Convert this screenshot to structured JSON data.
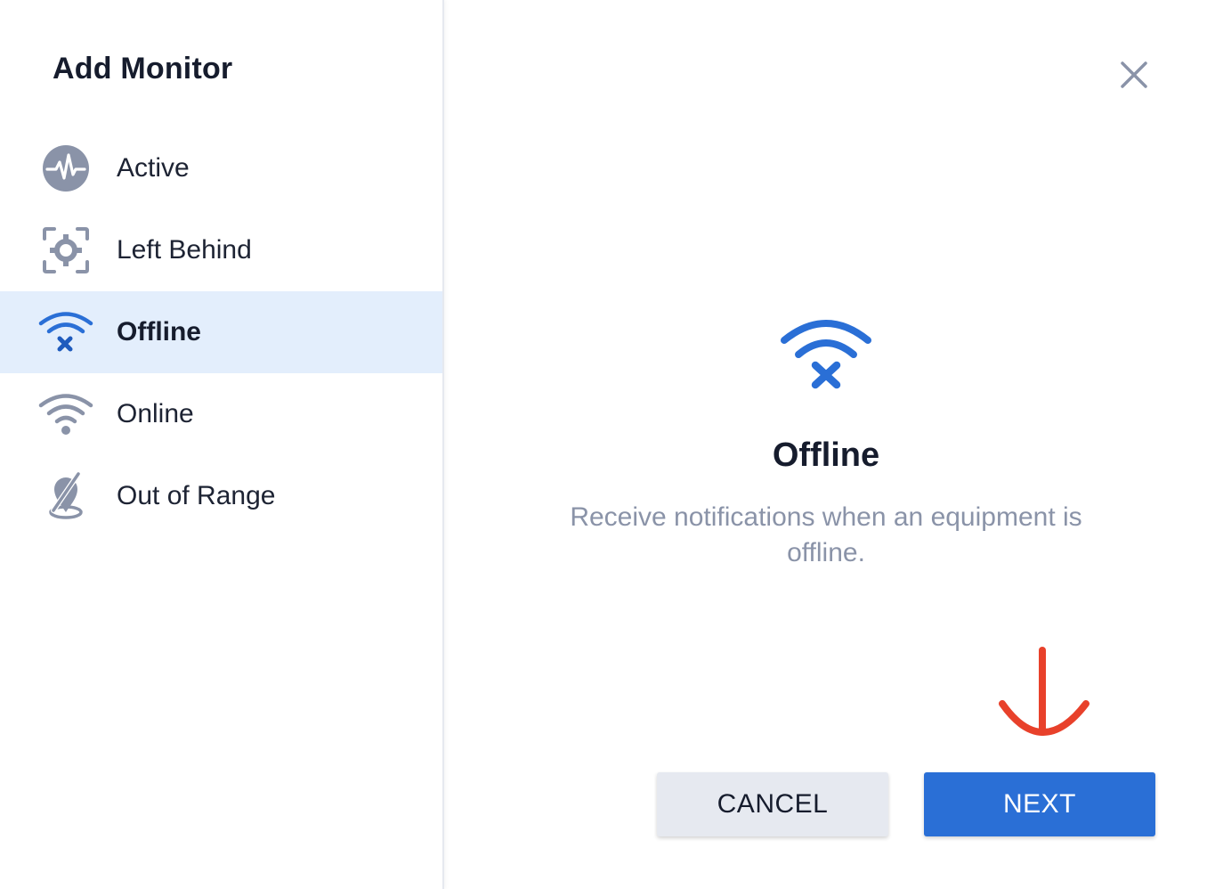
{
  "dialog": {
    "title": "Add Monitor",
    "close_icon": "close-icon"
  },
  "sidebar": {
    "items": [
      {
        "label": "Active",
        "icon": "pulse-icon",
        "selected": false
      },
      {
        "label": "Left Behind",
        "icon": "focus-target-icon",
        "selected": false
      },
      {
        "label": "Offline",
        "icon": "wifi-off-icon",
        "selected": true
      },
      {
        "label": "Online",
        "icon": "wifi-icon",
        "selected": false
      },
      {
        "label": "Out of Range",
        "icon": "location-off-icon",
        "selected": false
      }
    ]
  },
  "detail": {
    "icon": "wifi-off-icon",
    "title": "Offline",
    "description": "Receive notifications when an equipment is offline."
  },
  "footer": {
    "cancel_label": "CANCEL",
    "next_label": "NEXT"
  },
  "annotation": {
    "icon": "red-arrow-down-icon"
  },
  "colors": {
    "accent": "#2a6fd6",
    "selected_bg": "#e3eefc",
    "icon_gray": "#8a93a8",
    "text_dark": "#161c2d",
    "annotation_red": "#e8412b"
  }
}
